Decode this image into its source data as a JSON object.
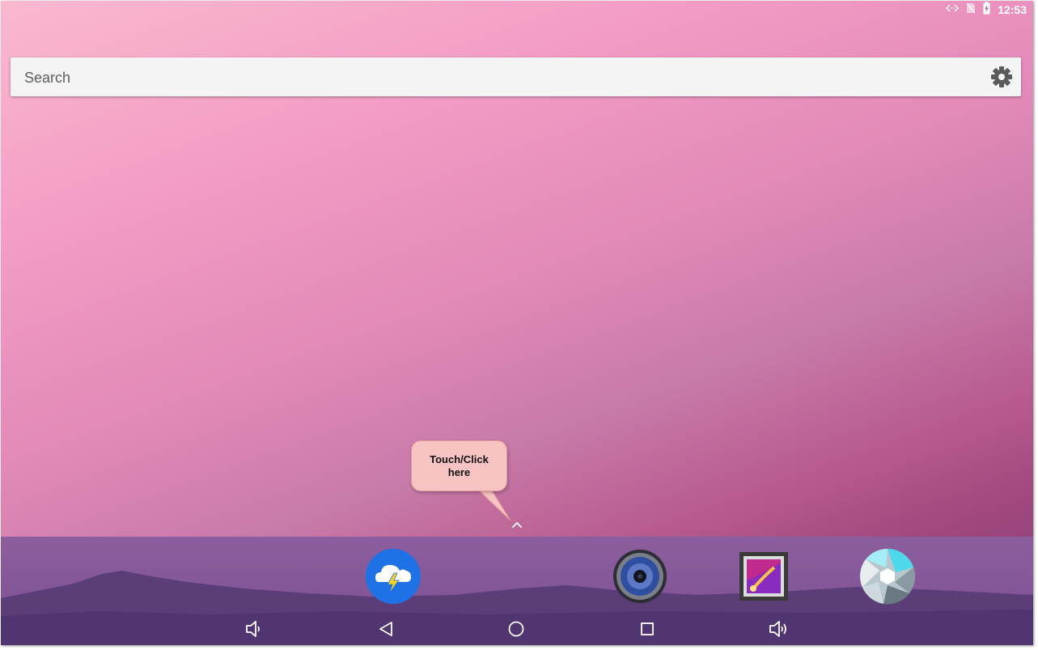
{
  "status_bar": {
    "icons": [
      "data-transfer-icon",
      "no-sim-icon",
      "battery-charging-icon"
    ],
    "time": "12:53"
  },
  "search": {
    "placeholder": "Search",
    "settings_icon": "gear-icon"
  },
  "callout": {
    "text": "Touch/Click here"
  },
  "all_apps": {
    "icon": "chevron-up-icon"
  },
  "dock": {
    "apps": [
      {
        "icon": "weather-storm-icon"
      },
      {
        "icon": "speaker-music-icon"
      },
      {
        "icon": "gallery-picture-icon"
      },
      {
        "icon": "camera-aperture-icon"
      }
    ]
  },
  "nav_bar": {
    "buttons": [
      {
        "icon": "volume-down-icon"
      },
      {
        "icon": "back-icon"
      },
      {
        "icon": "home-icon"
      },
      {
        "icon": "recents-icon"
      },
      {
        "icon": "volume-up-icon"
      }
    ]
  },
  "colors": {
    "callout_bg": "#f8c3c3",
    "search_bg": "#f4f4f4",
    "dock_bg": "#7a4f90"
  }
}
